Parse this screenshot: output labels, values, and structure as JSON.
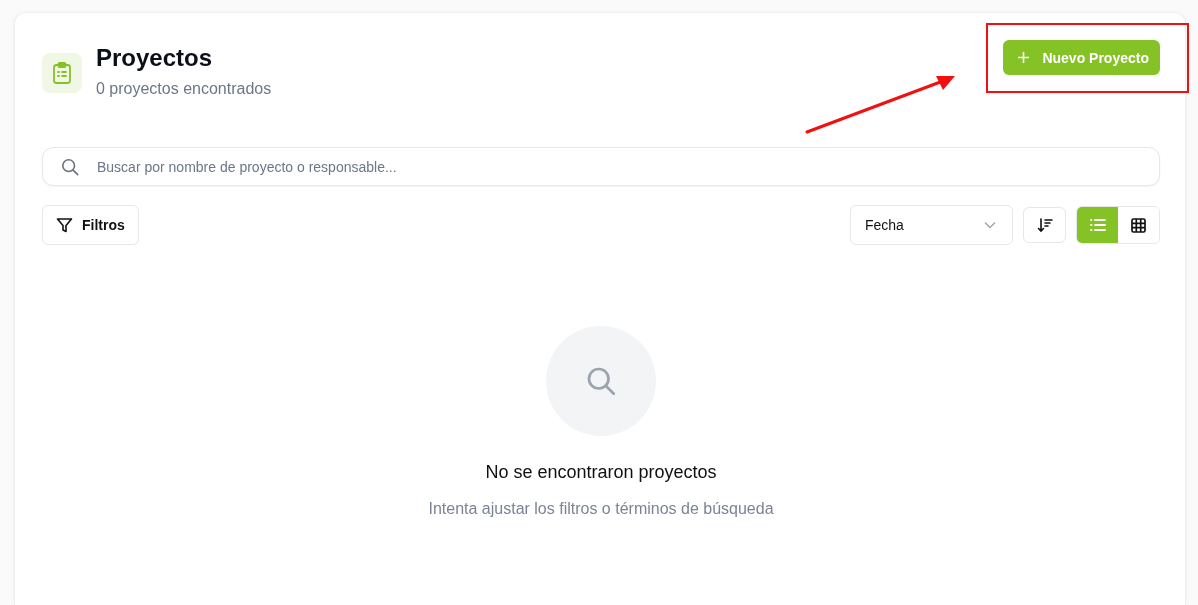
{
  "header": {
    "title": "Proyectos",
    "subtitle": "0 proyectos encontrados"
  },
  "new_button": {
    "label": "Nuevo Proyecto"
  },
  "search": {
    "placeholder": "Buscar por nombre de proyecto o responsable..."
  },
  "filters_button": {
    "label": "Filtros"
  },
  "sort_select": {
    "value": "Fecha"
  },
  "view_options": [
    {
      "kind": "list",
      "selected": true
    },
    {
      "kind": "grid",
      "selected": false
    }
  ],
  "empty_state": {
    "title": "No se encontraron proyectos",
    "message": "Intenta ajustar los filtros o términos de búsqueda"
  }
}
